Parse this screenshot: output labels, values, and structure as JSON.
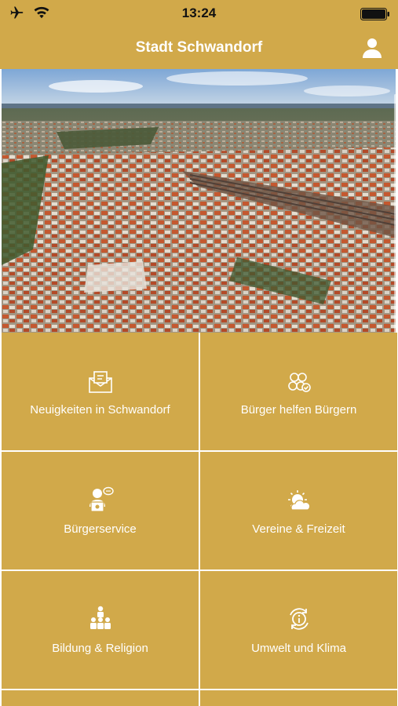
{
  "status_bar": {
    "time": "13:24",
    "icons": [
      "airplane-icon",
      "wifi-icon",
      "battery-icon"
    ]
  },
  "header": {
    "title": "Stadt Schwandorf",
    "profile_icon": "user-icon"
  },
  "colors": {
    "accent": "#d1a94a",
    "text_on_accent": "#ffffff"
  },
  "hero": {
    "image": "aerial-city-photo"
  },
  "tiles": [
    {
      "label": "Neuigkeiten in Schwandorf",
      "icon": "news-envelope-icon"
    },
    {
      "label": "Bürger helfen Bürgern",
      "icon": "people-group-icon"
    },
    {
      "label": "Bürgerservice",
      "icon": "service-person-icon"
    },
    {
      "label": "Vereine & Freizeit",
      "icon": "sun-cloud-icon"
    },
    {
      "label": "Bildung & Religion",
      "icon": "education-people-icon"
    },
    {
      "label": "Umwelt und Klima",
      "icon": "info-recycle-icon"
    }
  ]
}
